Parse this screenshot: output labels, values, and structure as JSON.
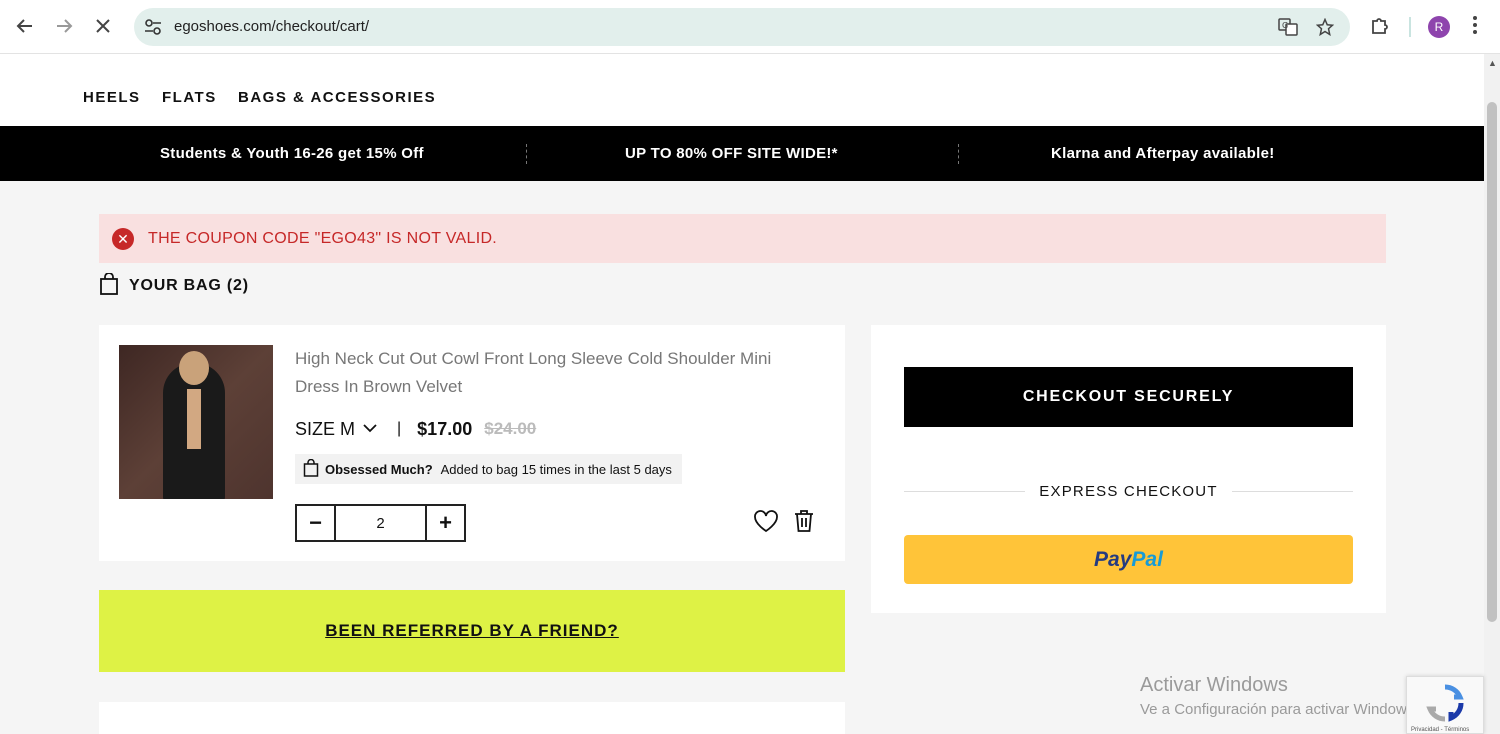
{
  "browser": {
    "url": "egoshoes.com/checkout/cart/",
    "profile_initial": "R"
  },
  "nav": {
    "items": [
      "HEELS",
      "FLATS",
      "BAGS & ACCESSORIES"
    ]
  },
  "promo": {
    "items": [
      "Students & Youth 16-26 get 15% Off",
      "UP TO 80% OFF SITE WIDE!*",
      "Klarna and Afterpay available!"
    ]
  },
  "alert": {
    "message": "THE COUPON CODE \"EGO43\" IS NOT VALID."
  },
  "bag": {
    "title": "YOUR BAG (2)"
  },
  "product": {
    "name": "High Neck Cut Out Cowl Front Long Sleeve Cold Shoulder Mini Dress In Brown Velvet",
    "size": "SIZE M",
    "separator": "|",
    "price": "$17.00",
    "old_price": "$24.00",
    "badge_title": "Obsessed Much?",
    "badge_text": "Added to bag 15 times in the last 5 days",
    "quantity": "2",
    "minus": "−",
    "plus": "+"
  },
  "referral": {
    "label": "BEEN REFERRED BY A FRIEND?"
  },
  "checkout": {
    "button_label": "CHECKOUT SECURELY",
    "express_label": "EXPRESS CHECKOUT",
    "paypal_pay": "Pay",
    "paypal_pal": "Pal"
  },
  "watermark": {
    "line1": "Activar Windows",
    "line2": "Ve a Configuración para activar Windows."
  },
  "recaptcha": {
    "terms": "Privacidad - Términos"
  },
  "colors": {
    "alert_bg": "#f9e0e0",
    "alert_text": "#c62828",
    "referral_bg": "#def245",
    "paypal_bg": "#ffc439"
  }
}
